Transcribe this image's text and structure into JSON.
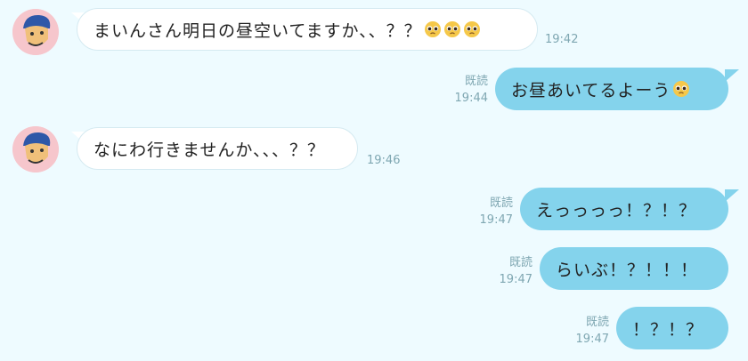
{
  "messages": [
    {
      "text": "まいんさん明日の昼空いてますか、、？？",
      "emoji_count": 3,
      "time": "19:42"
    },
    {
      "text": "お昼あいてるよーう",
      "emoji_count": 1,
      "read": "既読",
      "time": "19:44"
    },
    {
      "text": "なにわ行きませんか、、、？？",
      "time": "19:46"
    },
    {
      "text": "えっっっっ！？！？",
      "read": "既読",
      "time": "19:47"
    },
    {
      "text": "らいぶ！？！！！",
      "read": "既読",
      "time": "19:47"
    },
    {
      "text": "！？！？",
      "read": "既読",
      "time": "19:47"
    }
  ],
  "colors": {
    "background": "#eefbff",
    "incoming": "#ffffff",
    "outgoing": "#84d3ec",
    "meta": "#7fa7b2"
  },
  "icons": {
    "emoji": "pleading-face-icon",
    "avatar": "avatar-icon"
  }
}
